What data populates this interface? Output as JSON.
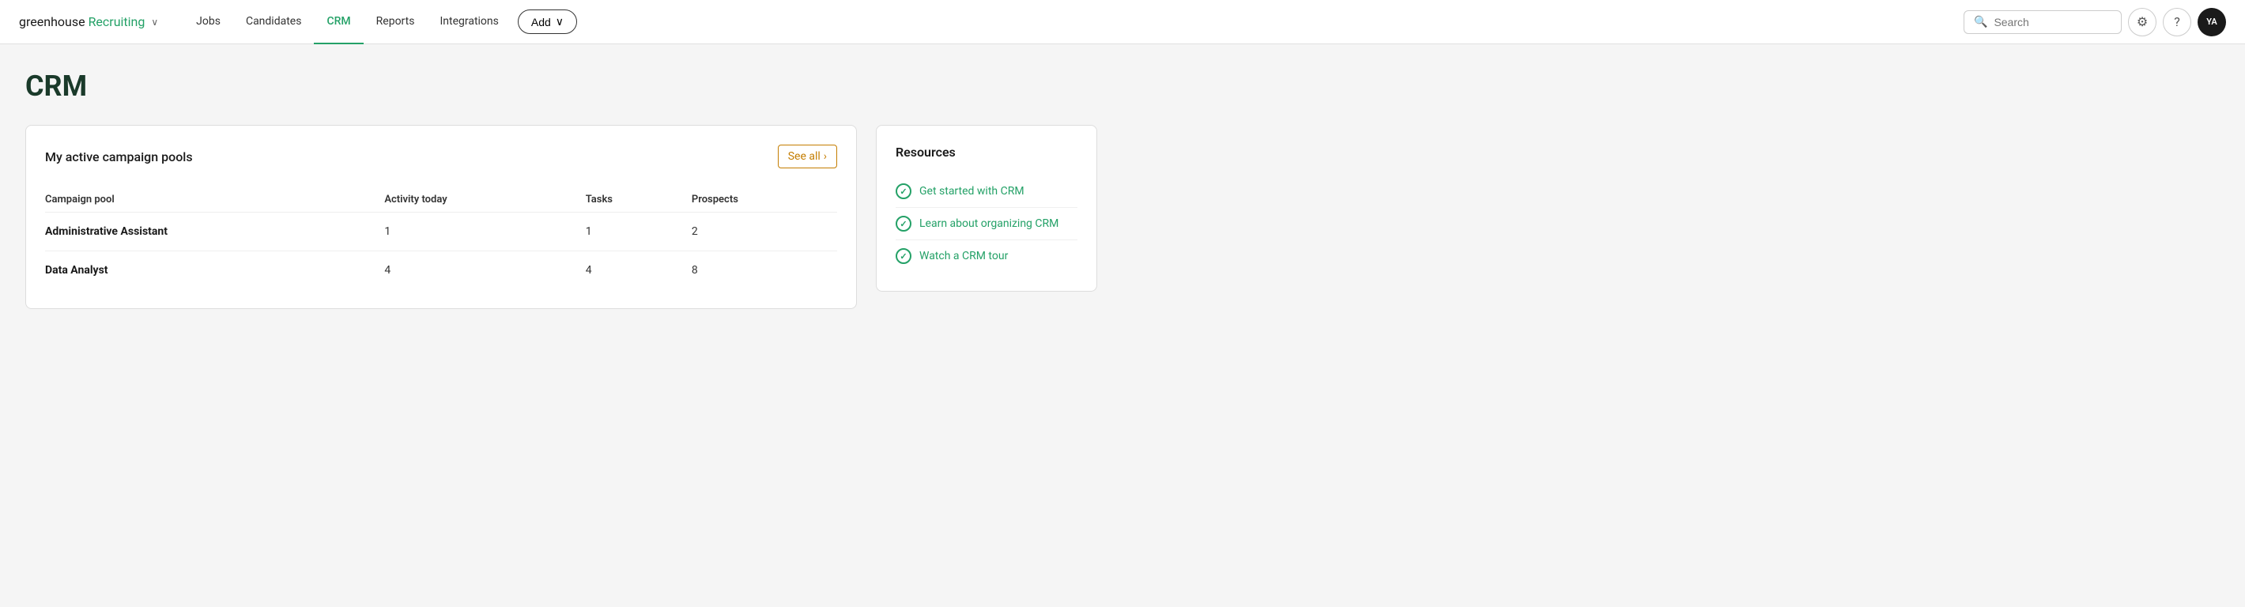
{
  "brand": {
    "greenhouse": "greenhouse",
    "recruiting": "Recruiting",
    "chevron": "∨"
  },
  "nav": {
    "links": [
      {
        "label": "Jobs",
        "active": false
      },
      {
        "label": "Candidates",
        "active": false
      },
      {
        "label": "CRM",
        "active": true
      },
      {
        "label": "Reports",
        "active": false
      },
      {
        "label": "Integrations",
        "active": false
      }
    ],
    "add_button": "Add",
    "add_chevron": "∨",
    "search_placeholder": "Search",
    "settings_icon": "⚙",
    "help_icon": "?",
    "avatar": "YA"
  },
  "page": {
    "title": "CRM"
  },
  "campaign_pools": {
    "card_title": "My active campaign pools",
    "see_all_label": "See all",
    "see_all_chevron": "›",
    "columns": [
      {
        "key": "campaign_pool",
        "label": "Campaign pool"
      },
      {
        "key": "activity_today",
        "label": "Activity today"
      },
      {
        "key": "tasks",
        "label": "Tasks"
      },
      {
        "key": "prospects",
        "label": "Prospects"
      }
    ],
    "rows": [
      {
        "campaign_pool": "Administrative Assistant",
        "activity_today": "1",
        "tasks": "1",
        "prospects": "2"
      },
      {
        "campaign_pool": "Data Analyst",
        "activity_today": "4",
        "tasks": "4",
        "prospects": "8"
      }
    ]
  },
  "resources": {
    "title": "Resources",
    "items": [
      {
        "label": "Get started with CRM",
        "icon": "✓"
      },
      {
        "label": "Learn about organizing CRM",
        "icon": "✓"
      },
      {
        "label": "Watch a CRM tour",
        "icon": "✓"
      }
    ]
  }
}
